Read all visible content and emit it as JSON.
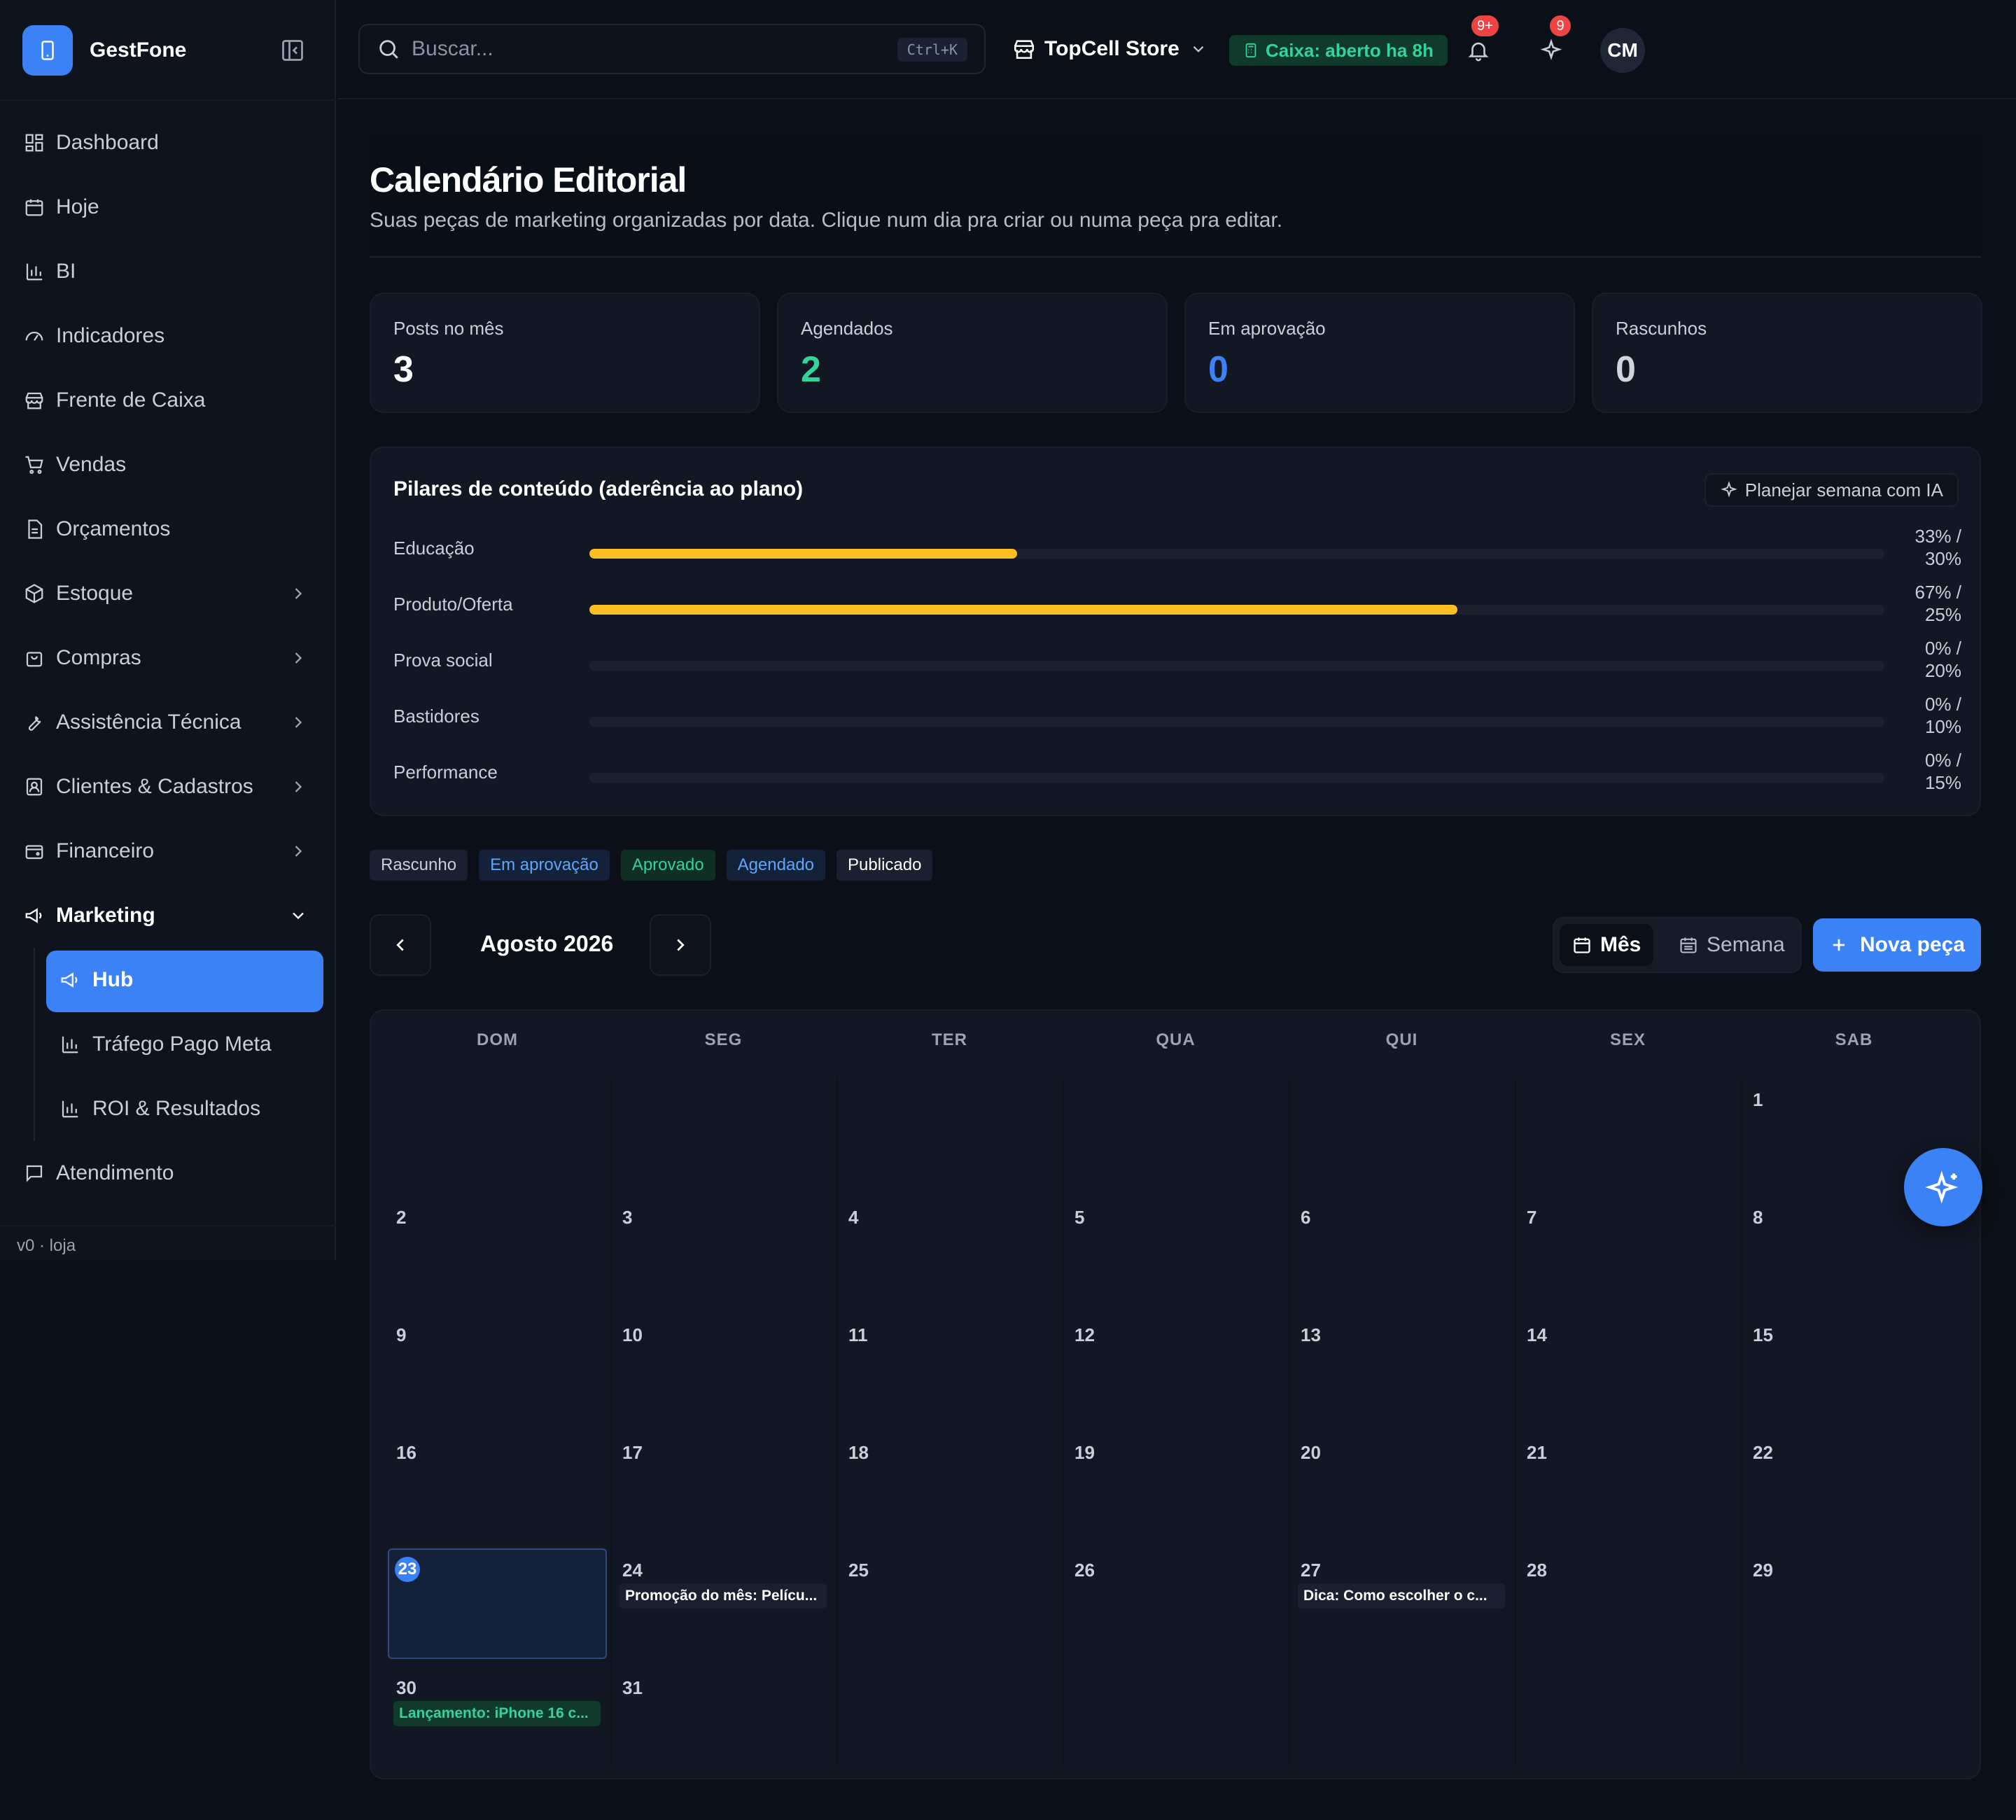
{
  "brand": {
    "name": "GestFone"
  },
  "sidebar": {
    "items": [
      {
        "label": "Dashboard",
        "icon": "dashboard-icon"
      },
      {
        "label": "Hoje",
        "icon": "calendar-icon"
      },
      {
        "label": "BI",
        "icon": "bar-chart-icon"
      },
      {
        "label": "Indicadores",
        "icon": "gauge-icon"
      },
      {
        "label": "Frente de Caixa",
        "icon": "store-icon"
      },
      {
        "label": "Vendas",
        "icon": "cart-icon"
      },
      {
        "label": "Orçamentos",
        "icon": "document-icon"
      },
      {
        "label": "Estoque",
        "icon": "package-icon"
      },
      {
        "label": "Compras",
        "icon": "shopping-bag-icon"
      },
      {
        "label": "Assistência Técnica",
        "icon": "wrench-icon"
      },
      {
        "label": "Clientes & Cadastros",
        "icon": "contacts-icon"
      },
      {
        "label": "Financeiro",
        "icon": "wallet-icon"
      },
      {
        "label": "Marketing",
        "icon": "megaphone-icon"
      }
    ],
    "marketing_sub": [
      {
        "label": "Hub",
        "icon": "megaphone-icon"
      },
      {
        "label": "Tráfego Pago Meta",
        "icon": "bar-chart-icon"
      },
      {
        "label": "ROI & Resultados",
        "icon": "bar-chart-icon"
      }
    ],
    "atendimento": "Atendimento",
    "version": "v0 · loja"
  },
  "topbar": {
    "search_placeholder": "Buscar...",
    "shortcut": "Ctrl+K",
    "store": "TopCell Store",
    "caixa": "Caixa: aberto ha 8h",
    "notifications_badge": "9+",
    "ai_badge": "9",
    "avatar": "CM"
  },
  "page": {
    "title": "Calendário Editorial",
    "subtitle": "Suas peças de marketing organizadas por data. Clique num dia pra criar ou numa peça pra editar."
  },
  "stats": [
    {
      "label": "Posts no mês",
      "value": "3",
      "color": "#ffffff"
    },
    {
      "label": "Agendados",
      "value": "2",
      "color": "#34d399"
    },
    {
      "label": "Em aprovação",
      "value": "0",
      "color": "#3b82f6"
    },
    {
      "label": "Rascunhos",
      "value": "0",
      "color": "#d1d5db"
    }
  ],
  "pillars": {
    "title": "Pilares de conteúdo (aderência ao plano)",
    "plan_button": "Planejar semana com IA",
    "rows": [
      {
        "name": "Educação",
        "actual": 0.33,
        "pct_line1": "33% /",
        "pct_line2": "30%"
      },
      {
        "name": "Produto/Oferta",
        "actual": 0.67,
        "pct_line1": "67% /",
        "pct_line2": "25%"
      },
      {
        "name": "Prova social",
        "actual": 0,
        "pct_line1": "0% /",
        "pct_line2": "20%"
      },
      {
        "name": "Bastidores",
        "actual": 0,
        "pct_line1": "0% /",
        "pct_line2": "10%"
      },
      {
        "name": "Performance",
        "actual": 0,
        "pct_line1": "0% /",
        "pct_line2": "15%"
      }
    ]
  },
  "legend": [
    {
      "label": "Rascunho",
      "bg": "#1a2030",
      "color": "#c9cfda"
    },
    {
      "label": "Em aprovação",
      "bg": "#132238",
      "color": "#60a5fa"
    },
    {
      "label": "Aprovado",
      "bg": "#0f2e24",
      "color": "#34d399"
    },
    {
      "label": "Agendado",
      "bg": "#132238",
      "color": "#60a5fa"
    },
    {
      "label": "Publicado",
      "bg": "#1a2030",
      "color": "#ffffff"
    }
  ],
  "calendar": {
    "month": "Agosto 2026",
    "view_month": "Mês",
    "view_week": "Semana",
    "new_button": "Nova peça",
    "weekdays": [
      "DOM",
      "SEG",
      "TER",
      "QUA",
      "QUI",
      "SEX",
      "SAB"
    ],
    "today": 23,
    "weeks": [
      [
        "",
        "",
        "",
        "",
        "",
        "",
        "1"
      ],
      [
        "2",
        "3",
        "4",
        "5",
        "6",
        "7",
        "8"
      ],
      [
        "9",
        "10",
        "11",
        "12",
        "13",
        "14",
        "15"
      ],
      [
        "16",
        "17",
        "18",
        "19",
        "20",
        "21",
        "22"
      ],
      [
        "23",
        "24",
        "25",
        "26",
        "27",
        "28",
        "29"
      ],
      [
        "30",
        "31",
        "",
        "",
        "",
        "",
        ""
      ]
    ],
    "events": [
      {
        "week": 4,
        "day": 1,
        "title": "Promoção do mês: Pelícu...",
        "status": "pub"
      },
      {
        "week": 4,
        "day": 4,
        "title": "Dica: Como escolher o c...",
        "status": "pub"
      },
      {
        "week": 5,
        "day": 0,
        "title": "Lançamento: iPhone 16 c...",
        "status": "apr"
      }
    ]
  }
}
